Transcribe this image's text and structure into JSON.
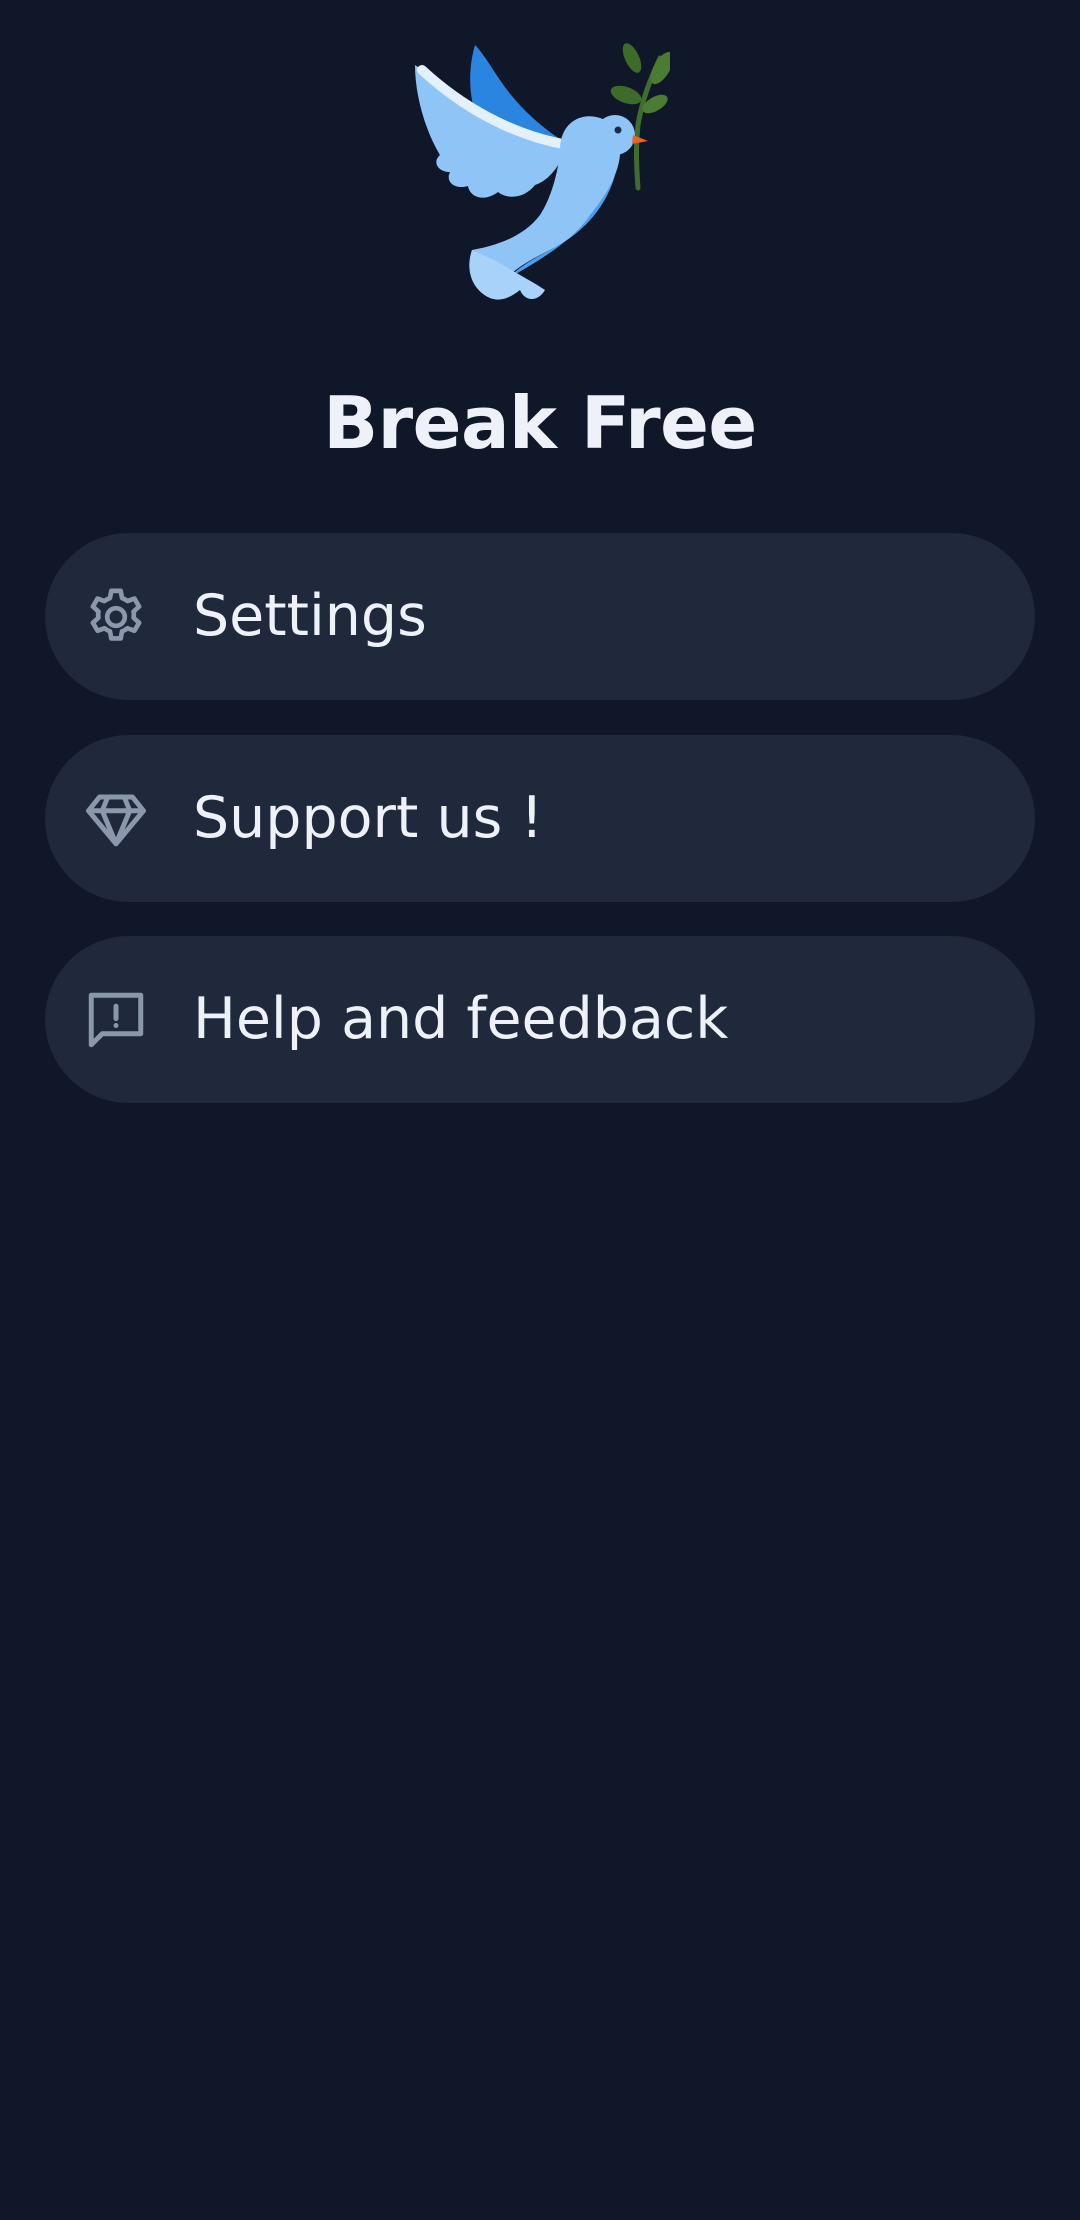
{
  "app": {
    "title": "Break Free",
    "logo_icon": "dove-with-olive-branch-icon"
  },
  "colors": {
    "background": "#101729",
    "card": "#1f293b",
    "text": "#eef1f7",
    "icon": "#8b97ab"
  },
  "menu": {
    "items": [
      {
        "label": "Settings",
        "icon": "gear-icon"
      },
      {
        "label": "Support us !",
        "icon": "diamond-icon"
      },
      {
        "label": "Help and feedback",
        "icon": "feedback-icon"
      }
    ]
  }
}
